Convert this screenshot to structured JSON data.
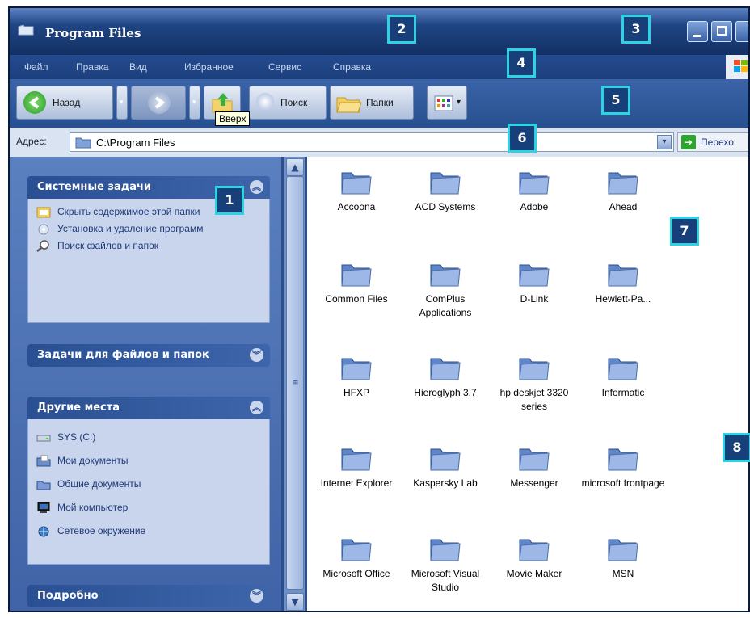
{
  "window": {
    "title": "Program Files"
  },
  "menu": [
    "Файл",
    "Правка",
    "Вид",
    "Избранное",
    "Сервис",
    "Справка"
  ],
  "toolbar": {
    "back_label": "Назад",
    "search_label": "Поиск",
    "folders_label": "Папки",
    "tooltip": "Вверх"
  },
  "address": {
    "label": "Адрес:",
    "path": "C:\\Program Files",
    "go_label": "Перехо"
  },
  "left_pane": {
    "system_tasks": {
      "title": "Системные задачи",
      "items": [
        "Скрыть содержимое этой папки",
        "Установка и удаление программ",
        "Поиск файлов и папок"
      ]
    },
    "file_tasks": {
      "title": "Задачи для файлов и папок"
    },
    "other_places": {
      "title": "Другие места",
      "items": [
        "SYS (C:)",
        "Мои документы",
        "Общие документы",
        "Мой компьютер",
        "Сетевое окружение"
      ]
    },
    "details": {
      "title": "Подробно"
    }
  },
  "folders": [
    "Accoona",
    "ACD Systems",
    "Adobe",
    "Ahead",
    "Common Files",
    "ComPlus Applications",
    "D-Link",
    "Hewlett-Pa...",
    "HFXP",
    "Hieroglyph 3.7",
    "hp deskjet 3320 series",
    "Informatic",
    "Internet Explorer",
    "Kaspersky Lab",
    "Messenger",
    "microsoft frontpage",
    "Microsoft Office",
    "Microsoft Visual Studio",
    "Movie Maker",
    "MSN"
  ],
  "callouts": [
    "1",
    "2",
    "3",
    "4",
    "5",
    "6",
    "7",
    "8"
  ],
  "colors": {
    "titlebar": "#1f4584",
    "task_pane": "#5b80c0",
    "callout_border": "#2ed3e3",
    "callout_fill": "#173f7a"
  }
}
